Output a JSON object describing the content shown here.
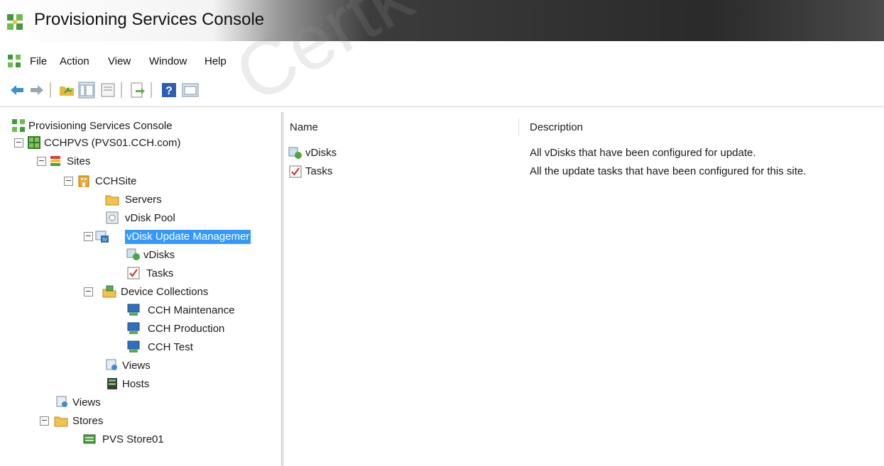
{
  "window": {
    "title": "Provisioning Services Console",
    "icon": "console-grid-icon"
  },
  "menu": [
    "File",
    "Action",
    "View",
    "Window",
    "Help"
  ],
  "toolbar": {
    "buttons": [
      "back-arrow-icon",
      "forward-arrow-icon",
      "up-folder-icon",
      "show-hide-tree-icon",
      "export-list-icon",
      "help-icon",
      "properties-icon"
    ]
  },
  "tree": {
    "root": "Provisioning Services Console",
    "farm": "CCHPVS (PVS01.CCH.com)",
    "sites": "Sites",
    "site": "CCHSite",
    "servers": "Servers",
    "vdisk_pool": "vDisk Pool",
    "vdisk_update": "vDisk Update Managemer",
    "vdisks": "vDisks",
    "tasks": "Tasks",
    "device_collections": "Device Collections",
    "col_maint": "CCH Maintenance",
    "col_prod": "CCH Production",
    "col_test": "CCH Test",
    "site_views": "Views",
    "hosts": "Hosts",
    "views": "Views",
    "stores": "Stores",
    "store1": "PVS Store01"
  },
  "list": {
    "columns": [
      "Name",
      "Description"
    ],
    "rows": [
      {
        "name": "vDisks",
        "description": "All vDisks that have been configured for update."
      },
      {
        "name": "Tasks",
        "description": "All the update tasks that have been configured for this site."
      }
    ]
  },
  "watermark": "Certk"
}
